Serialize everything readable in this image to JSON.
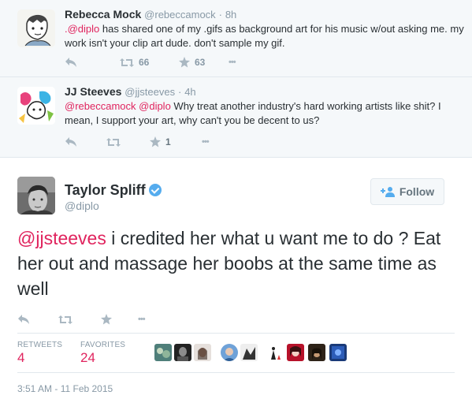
{
  "tweet1": {
    "fullname": "Rebecca Mock",
    "screenname": "@rebeccamock",
    "time": "8h",
    "mention": ".@diplo",
    "text_rest": " has shared one of my .gifs as background art for his music w/out asking me. my work isn't your clip art dude. don't sample my gif.",
    "retweets": "66",
    "favorites": "63",
    "more": "•••"
  },
  "tweet2": {
    "fullname": "JJ Steeves",
    "screenname": "@jjsteeves",
    "time": "4h",
    "mention1": "@rebeccamock",
    "mention2": "@diplo",
    "text_rest": " Why treat another industry's hard working artists like shit? I mean, I support your art, why can't you be decent to us?",
    "retweets": "",
    "favorites": "1",
    "more": "•••"
  },
  "main": {
    "fullname": "Taylor Spliff",
    "screenname": "@diplo",
    "follow_label": "Follow",
    "mention": "@jjsteeves",
    "text_rest": " i credited her what u want me to do ? Eat her out and massage her boobs at the same time as well",
    "more": "•••",
    "retweets_label": "RETWEETS",
    "retweets_count": "4",
    "favorites_label": "FAVORITES",
    "favorites_count": "24",
    "timestamp": "3:51 AM - 11 Feb 2015"
  },
  "colors": {
    "accent": "#e0245e",
    "verified": "#55acee",
    "muted": "#8899a6",
    "icon": "#aab8c2"
  }
}
